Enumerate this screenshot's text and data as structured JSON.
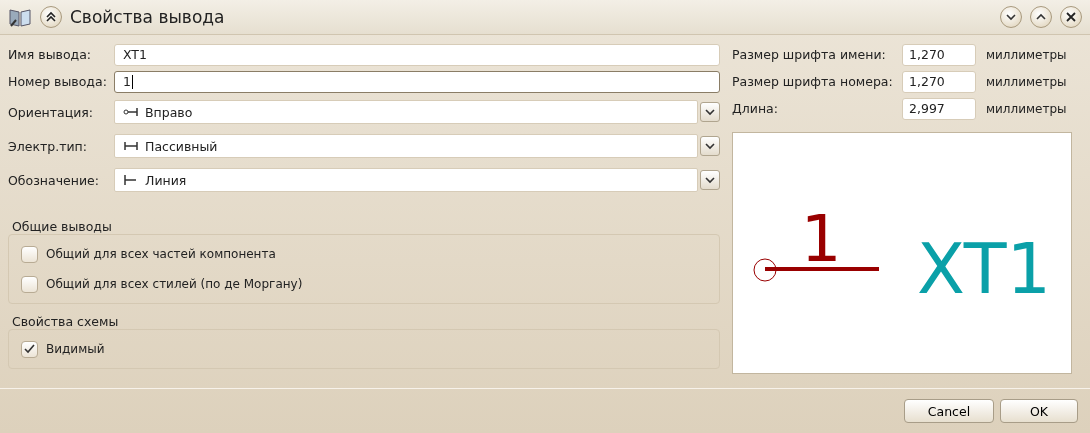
{
  "window": {
    "title": "Свойства вывода"
  },
  "fields": [
    {
      "kind": "text",
      "label": "Имя вывода:",
      "value": "XT1",
      "focused": false
    },
    {
      "kind": "text",
      "label": "Номер вывода:",
      "value": "1",
      "focused": true
    },
    {
      "kind": "dropdown",
      "label": "Ориентация:",
      "value": "Вправо"
    },
    {
      "kind": "dropdown",
      "label": "Электр.тип:",
      "value": "Пассивный"
    },
    {
      "kind": "dropdown",
      "label": "Обозначение:",
      "value": "Линия"
    }
  ],
  "sizes": [
    {
      "label": "Размер шрифта имени:",
      "value": "1,270",
      "unit": "миллиметры"
    },
    {
      "label": "Размер шрифта номера:",
      "value": "1,270",
      "unit": "миллиметры"
    },
    {
      "label": "Длина:",
      "value": "2,997",
      "unit": "миллиметры"
    }
  ],
  "groups": [
    {
      "title": "Общие выводы",
      "options": [
        {
          "label": "Общий для всех частей компонента",
          "checked": false
        },
        {
          "label": "Общий для всех стилей (по де Моргану)",
          "checked": false
        }
      ]
    },
    {
      "title": "Свойства схемы",
      "options": [
        {
          "label": "Видимый",
          "checked": true
        }
      ]
    }
  ],
  "preview": {
    "pin_number": "1",
    "pin_name": "XT1"
  },
  "buttons": [
    "Cancel",
    "OK"
  ]
}
